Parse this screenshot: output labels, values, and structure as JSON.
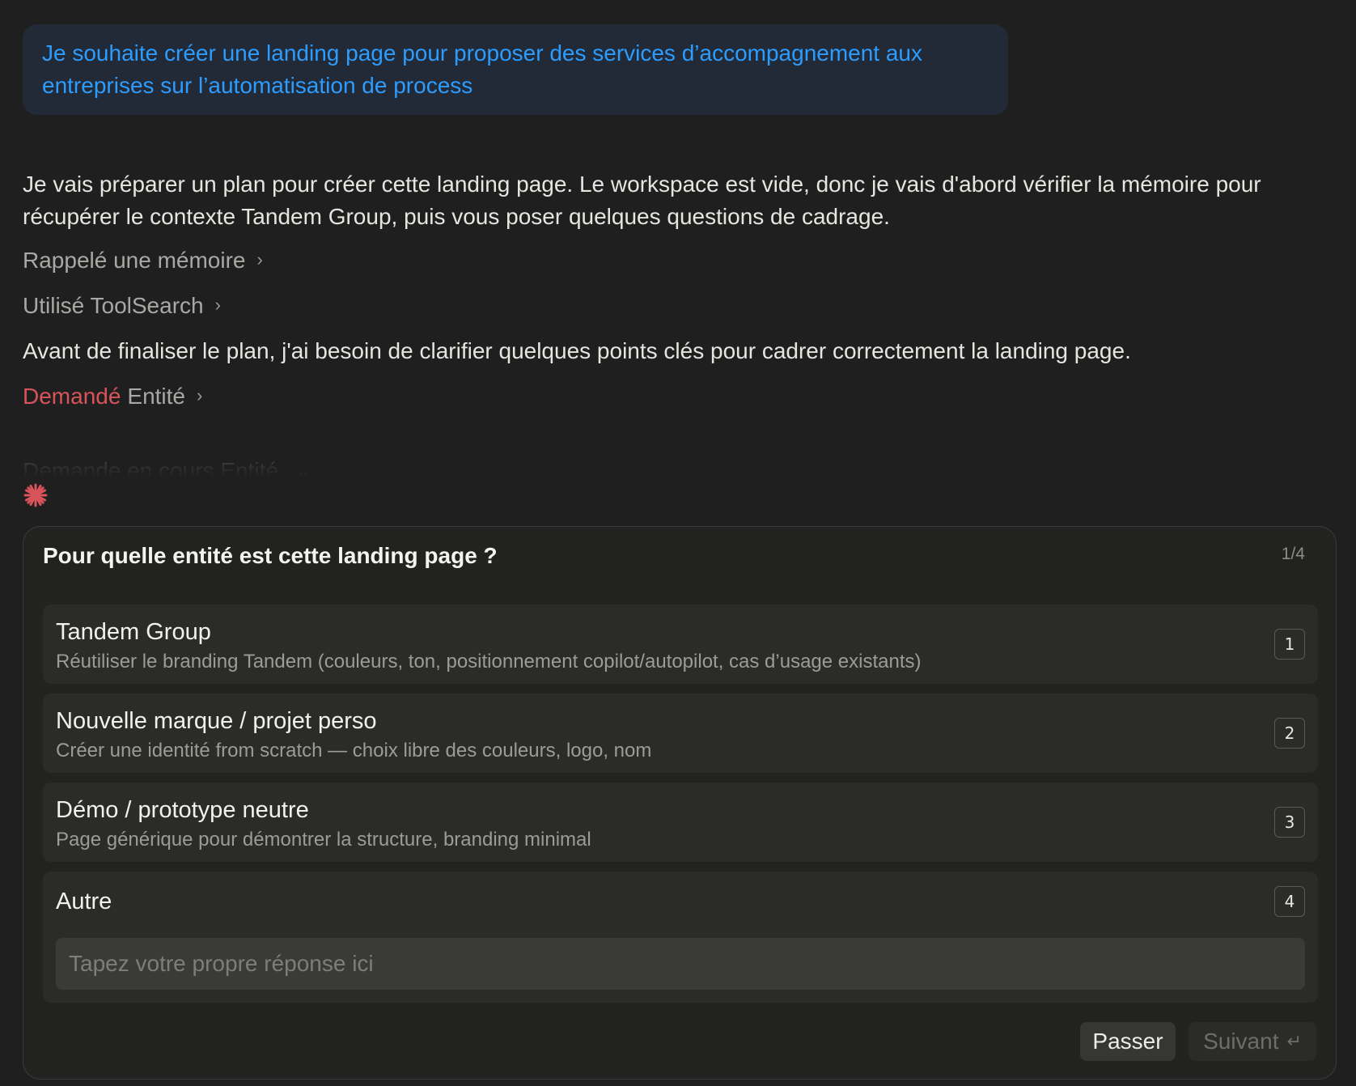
{
  "user_message": "Je souhaite créer une landing page pour proposer des services d’accompagnement aux entreprises sur l’automatisation de process",
  "assistant": {
    "intro": "Je vais préparer un plan pour créer cette landing page. Le workspace est vide, donc je vais d'abord vérifier la mémoire pour récupérer le contexte Tandem Group, puis vous poser quelques questions de cadrage.",
    "tool_memory": "Rappelé une mémoire",
    "tool_search": "Utilisé ToolSearch",
    "clarify": "Avant de finaliser le plan, j'ai besoin de clarifier quelques points clés pour cadrer correctement la landing page.",
    "asked_prefix": "Demandé",
    "asked_label": "Entité",
    "pending_label": "Demande en cours Entité"
  },
  "question": {
    "title": "Pour quelle entité est cette landing page ?",
    "counter": "1/4",
    "options": [
      {
        "title": "Tandem Group",
        "desc": "Réutiliser le branding Tandem (couleurs, ton, positionnement copilot/autopilot, cas d’usage existants)",
        "key": "1"
      },
      {
        "title": "Nouvelle marque / projet perso",
        "desc": "Créer une identité from scratch — choix libre des couleurs, logo, nom",
        "key": "2"
      },
      {
        "title": "Démo / prototype neutre",
        "desc": "Page générique pour démontrer la structure, branding minimal",
        "key": "3"
      },
      {
        "title": "Autre",
        "key": "4",
        "placeholder": "Tapez votre propre réponse ici"
      }
    ],
    "skip_label": "Passer",
    "next_label": "Suivant"
  },
  "colors": {
    "accent_blue": "#2d9cff",
    "accent_red": "#d9545a",
    "background": "#1f1f1f"
  }
}
